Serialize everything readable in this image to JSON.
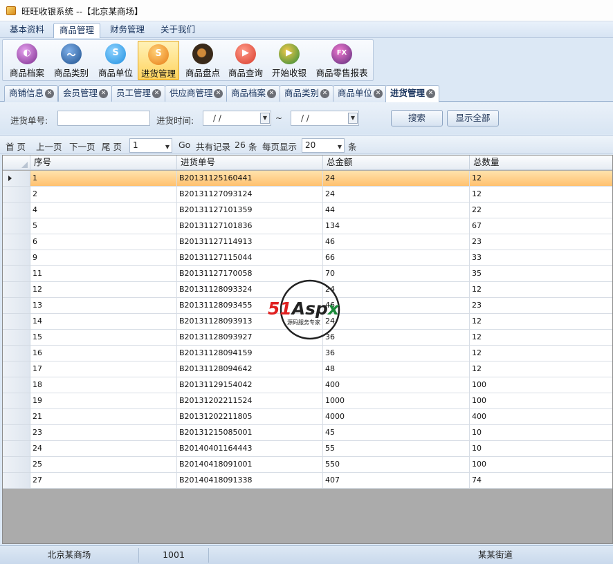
{
  "window": {
    "title": "旺旺收银系统 --【北京某商场】"
  },
  "menu": {
    "items": [
      {
        "label": "基本资料",
        "active": false
      },
      {
        "label": "商品管理",
        "active": true
      },
      {
        "label": "财务管理",
        "active": false
      },
      {
        "label": "关于我们",
        "active": false
      }
    ]
  },
  "ribbon": {
    "buttons": [
      {
        "label": "商品档案",
        "icon": "product-archive-icon",
        "color": "#7a2a8c",
        "glyph": "◐"
      },
      {
        "label": "商品类别",
        "icon": "product-category-icon",
        "color": "#1d4f8c",
        "glyph": "〜"
      },
      {
        "label": "商品单位",
        "icon": "product-unit-icon",
        "color": "#1f8fe0",
        "glyph": "S"
      },
      {
        "label": "进货管理",
        "icon": "purchase-management-icon",
        "color": "#e77b13",
        "glyph": "S",
        "active": true
      },
      {
        "label": "商品盘点",
        "icon": "inventory-check-icon",
        "color": "#3a2a1a",
        "glyph": "●"
      },
      {
        "label": "商品查询",
        "icon": "product-query-icon",
        "color": "#d83a2a",
        "glyph": "▶"
      },
      {
        "label": "开始收银",
        "icon": "start-cashier-icon",
        "color": "#2c8a3a",
        "glyph": "▶"
      },
      {
        "label": "商品零售报表",
        "icon": "retail-report-icon",
        "color": "#5a2a7a",
        "glyph": "FX"
      }
    ]
  },
  "tabs": [
    {
      "label": "商铺信息"
    },
    {
      "label": "会员管理"
    },
    {
      "label": "员工管理"
    },
    {
      "label": "供应商管理"
    },
    {
      "label": "商品档案"
    },
    {
      "label": "商品类别"
    },
    {
      "label": "商品单位"
    },
    {
      "label": "进货管理",
      "active": true
    }
  ],
  "search": {
    "order_no_label": "进货单号:",
    "order_no_value": "",
    "time_label": "进货时间:",
    "date_from": "/  /",
    "tilde": "~",
    "date_to": "/  /",
    "search_button": "搜索",
    "show_all_button": "显示全部"
  },
  "pager": {
    "first": "首 页",
    "prev": "上一页",
    "next": "下一页",
    "last": "尾 页",
    "page_value": "1",
    "go": "Go",
    "total_prefix": "共有记录",
    "total_count": "26",
    "total_suffix": "条",
    "per_page_label": "每页显示",
    "per_page_value": "20",
    "per_page_suffix": "条"
  },
  "grid": {
    "columns": [
      "序号",
      "进货单号",
      "总金额",
      "总数量"
    ],
    "rows": [
      [
        "1",
        "B20131125160441",
        "24",
        "12"
      ],
      [
        "2",
        "B20131127093124",
        "24",
        "12"
      ],
      [
        "4",
        "B20131127101359",
        "44",
        "22"
      ],
      [
        "5",
        "B20131127101836",
        "134",
        "67"
      ],
      [
        "6",
        "B20131127114913",
        "46",
        "23"
      ],
      [
        "9",
        "B20131127115044",
        "66",
        "33"
      ],
      [
        "11",
        "B20131127170058",
        "70",
        "35"
      ],
      [
        "12",
        "B20131128093324",
        "24",
        "12"
      ],
      [
        "13",
        "B20131128093455",
        "46",
        "23"
      ],
      [
        "14",
        "B20131128093913",
        "24",
        "12"
      ],
      [
        "15",
        "B20131128093927",
        "36",
        "12"
      ],
      [
        "16",
        "B20131128094159",
        "36",
        "12"
      ],
      [
        "17",
        "B20131128094642",
        "48",
        "12"
      ],
      [
        "18",
        "B20131129154042",
        "400",
        "100"
      ],
      [
        "19",
        "B20131202211524",
        "1000",
        "100"
      ],
      [
        "21",
        "B20131202211805",
        "4000",
        "400"
      ],
      [
        "23",
        "B20131215085001",
        "45",
        "10"
      ],
      [
        "24",
        "B20140401164443",
        "55",
        "10"
      ],
      [
        "25",
        "B20140418091001",
        "550",
        "100"
      ],
      [
        "27",
        "B20140418091338",
        "407",
        "74"
      ]
    ],
    "selected_row": 0
  },
  "status": {
    "shop": "北京某商场",
    "user_id": "1001",
    "address": "某某街道"
  },
  "watermark": {
    "brand": "51Aspx",
    "slogan": "源码服务专家"
  }
}
